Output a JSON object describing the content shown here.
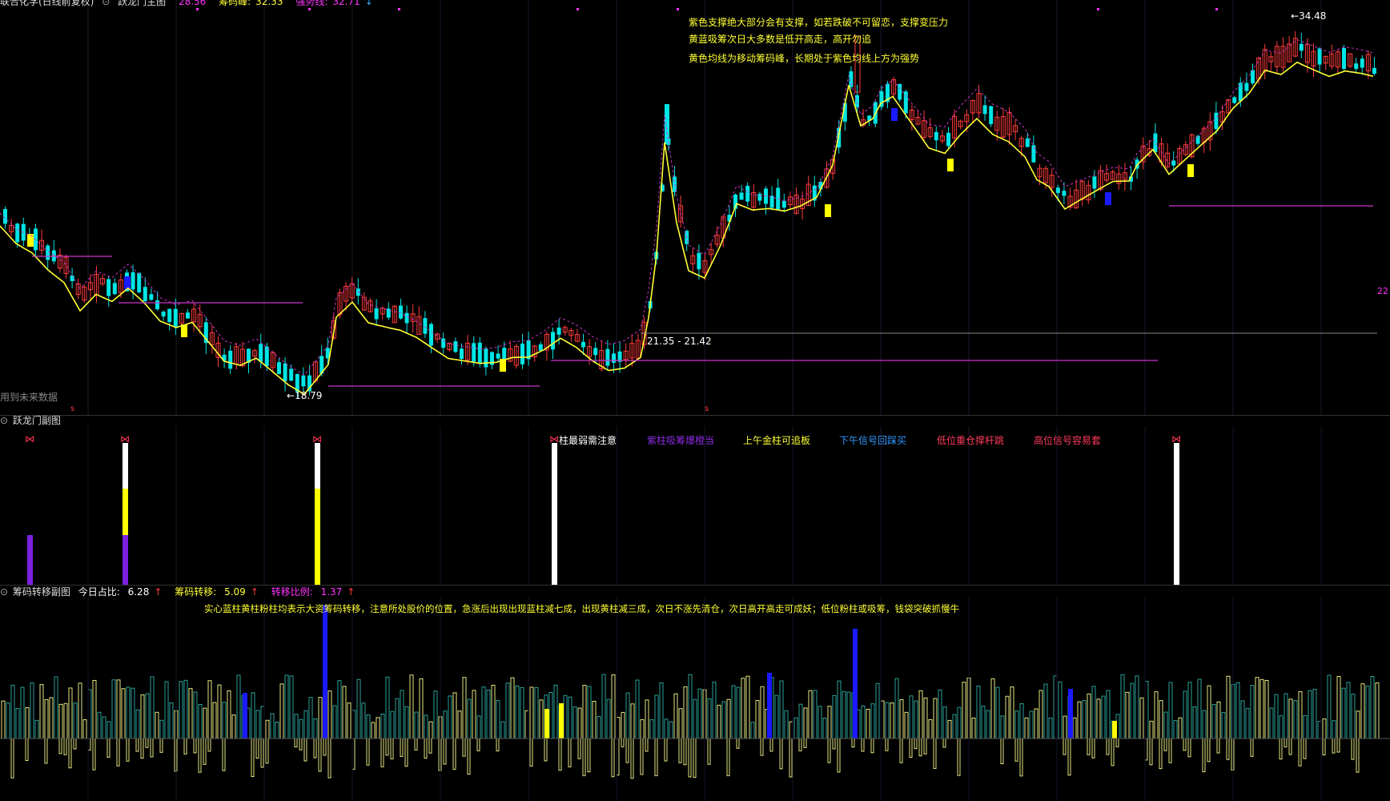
{
  "main_header": {
    "title": "联合化学(日线前复权)",
    "indicator": "跃龙门主图",
    "v1_label": "",
    "v1": "28.56",
    "v2_label": "筹码峰:",
    "v2": "32.33",
    "v3_label": "强势线:",
    "v3": "32.71",
    "v3_arrow": "↓"
  },
  "main_notes": [
    "紫色支撑绝大部分会有支撑，如若跌破不可留恋，支撑变压力",
    "黄蓝吸筹次日大多数是低开高走，高开勿追",
    "黄色均线为移动筹码峰，长期处于紫色均线上方为强势"
  ],
  "main_labels": {
    "high_mark": "34.48",
    "low_mark": "18.79",
    "range_mark": "21.35 - 21.42",
    "future_note": "用到未来数据",
    "right_axis": "22",
    "s_mark": "s"
  },
  "sub1": {
    "title": "跃龙门副图",
    "legend": [
      "柱最弱需注意",
      "紫柱吸筹爆橙当",
      "上午金柱可追板",
      "下午信号回踩买",
      "低位重仓撑杆跳",
      "高位信号容易套"
    ],
    "legend_colors": [
      "#ffffff",
      "#8b2be2",
      "#ffff33",
      "#3399ff",
      "#ff3b5c",
      "#ff3b5c"
    ]
  },
  "sub2": {
    "title": "筹码转移副图",
    "m1_label": "今日占比:",
    "m1": "6.28",
    "m2_label": "筹码转移:",
    "m2": "5.09",
    "m3_label": "转移比例:",
    "m3": "1.37",
    "arrow": "↑",
    "note": "实心蓝柱黄柱粉柱均表示大资筹码转移，注意所处股价的位置，急涨后出现出现蓝柱减七成，出现黄柱减三成，次日不涨先清仓，次日高开高走可成妖；低位粉柱或吸筹，钱袋突破抓慢牛"
  },
  "colors": {
    "up": "#ff3b3b",
    "down": "#00e5e5",
    "ma": "#ffff33",
    "support": "#cc33cc",
    "volume_line": "#2aa198",
    "volume_low": "#e5e580",
    "bar_blue": "#1a1aff",
    "bar_yellow": "#ffff00"
  }
}
